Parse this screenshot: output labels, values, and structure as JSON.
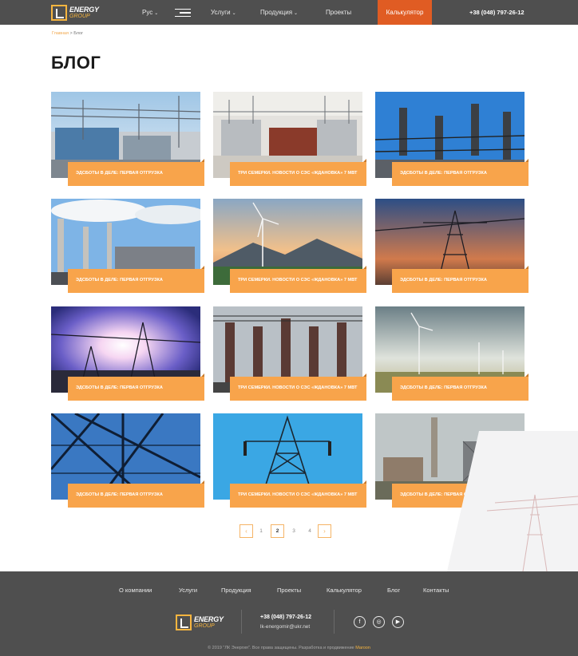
{
  "header": {
    "logo": {
      "line1": "ENERGY",
      "line2": "GROUP"
    },
    "language": "Рус",
    "services": "Услуги",
    "products": "Продукция",
    "projects": "Проекты",
    "calculator": "Калькулятор",
    "phone": "+38 (048) 797-26-12"
  },
  "breadcrumb": {
    "home": "Главная",
    "separator": ">",
    "current": "Блог"
  },
  "page_title": "БЛОГ",
  "cards": [
    {
      "caption": "ЭДСБОТЫ В ДЕЛЕ: ПЕРВАЯ ОТГРУЗКА"
    },
    {
      "caption": "ТРИ СЕМЕРКИ. НОВОСТИ О СЭС «ЖДАНОВКА» 7 МВТ"
    },
    {
      "caption": "ЭДСБОТЫ В ДЕЛЕ: ПЕРВАЯ ОТГРУЗКА"
    },
    {
      "caption": "ЭДСБОТЫ В ДЕЛЕ: ПЕРВАЯ ОТГРУЗКА"
    },
    {
      "caption": "ТРИ СЕМЕРКИ. НОВОСТИ О СЭС «ЖДАНОВКА» 7 МВТ"
    },
    {
      "caption": "ЭДСБОТЫ В ДЕЛЕ: ПЕРВАЯ ОТГРУЗКА"
    },
    {
      "caption": "ЭДСБОТЫ В ДЕЛЕ: ПЕРВАЯ ОТГРУЗКА"
    },
    {
      "caption": "ТРИ СЕМЕРКИ. НОВОСТИ О СЭС «ЖДАНОВКА» 7 МВТ"
    },
    {
      "caption": "ЭДСБОТЫ В ДЕЛЕ: ПЕРВАЯ ОТГРУЗКА"
    },
    {
      "caption": "ЭДСБОТЫ В ДЕЛЕ: ПЕРВАЯ ОТГРУЗКА"
    },
    {
      "caption": "ТРИ СЕМЕРКИ. НОВОСТИ О СЭС «ЖДАНОВКА» 7 МВТ"
    },
    {
      "caption": "ЭДСБОТЫ В ДЕЛЕ: ПЕРВАЯ ОТГРУЗКА"
    }
  ],
  "pagination": {
    "prev": "‹",
    "pages": [
      "1",
      "2",
      "3",
      "4"
    ],
    "current": "2",
    "next": "›"
  },
  "footer": {
    "nav": [
      "О компании",
      "Услуги",
      "Продукция",
      "Проекты",
      "Калькулятор",
      "Блог",
      "Контакты"
    ],
    "logo": {
      "line1": "ENERGY",
      "line2": "GROUP"
    },
    "phone": "+38 (048) 797-26-12",
    "email": "lk-energomir@ukr.net",
    "social": [
      "facebook-icon",
      "instagram-icon",
      "youtube-icon"
    ],
    "copyright": "© 2019 \"ЛК Энергия\". Все права защищены. Разработка и продвижение",
    "developer": "Maroon"
  },
  "colors": {
    "accent": "#f8a44b",
    "header_bg": "#4f4f4f",
    "calc_bg": "#e05c23"
  }
}
